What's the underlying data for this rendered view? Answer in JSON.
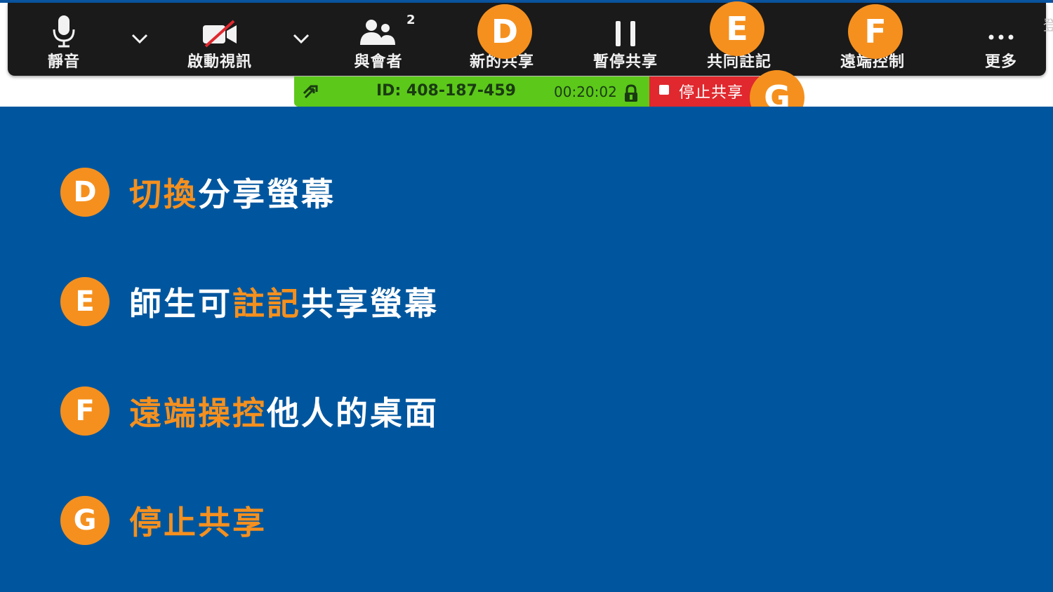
{
  "toolbar": {
    "mute_label": "靜音",
    "video_label": "啟動視訊",
    "participants_label": "與會者",
    "participants_count": "2",
    "new_share_label": "新的共享",
    "pause_share_label": "暫停共享",
    "annotate_label": "共同註記",
    "remote_control_label": "遠端控制",
    "more_label": "更多"
  },
  "badges": {
    "d": "D",
    "e": "E",
    "f": "F",
    "g": "G"
  },
  "status_bar": {
    "meeting_id": "ID: 408-187-459",
    "elapsed": "00:20:02",
    "stop_share_label": "停止共享"
  },
  "legend": [
    {
      "letter": "D",
      "highlight": "切換",
      "rest": "分享螢幕"
    },
    {
      "letter": "E",
      "prefix": "師生可",
      "highlight": "註記",
      "rest": "共享螢幕"
    },
    {
      "letter": "F",
      "highlight": "遠端操控",
      "rest": "他人的桌面"
    },
    {
      "letter": "G",
      "highlight": "停止共享",
      "rest": ""
    }
  ],
  "colors": {
    "accent_orange": "#f5901e",
    "panel_blue": "#00569e",
    "toolbar_dark": "#1a1a1a",
    "status_green": "#5cc81a",
    "stop_red": "#e0282e"
  }
}
